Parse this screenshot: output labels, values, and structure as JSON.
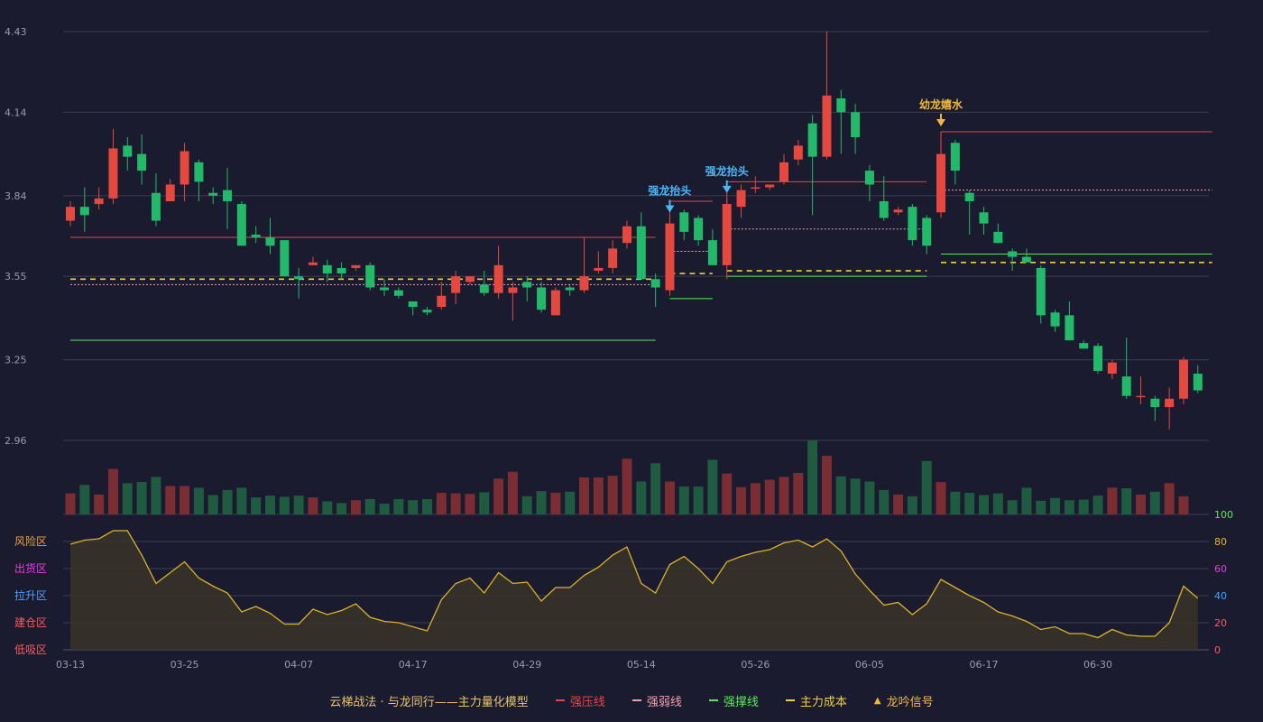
{
  "chart_data": {
    "type": "candlestick",
    "price_axis": {
      "ticks": [
        "4.43",
        "4.14",
        "3.84",
        "3.55",
        "3.25",
        "2.96"
      ],
      "range": [
        2.96,
        4.43
      ]
    },
    "indicator_axis": {
      "ticks": [
        "100",
        "80",
        "60",
        "40",
        "20",
        "0"
      ],
      "range": [
        0,
        100
      ]
    },
    "zone_labels": [
      "风险区",
      "出货区",
      "拉升区",
      "建仓区",
      "低吸区"
    ],
    "x_tick_labels": [
      {
        "label": "03-13",
        "index": 0
      },
      {
        "label": "03-25",
        "index": 8
      },
      {
        "label": "04-07",
        "index": 16
      },
      {
        "label": "04-17",
        "index": 24
      },
      {
        "label": "04-29",
        "index": 32
      },
      {
        "label": "05-14",
        "index": 40
      },
      {
        "label": "05-26",
        "index": 48
      },
      {
        "label": "06-05",
        "index": 56
      },
      {
        "label": "06-17",
        "index": 64
      },
      {
        "label": "06-30",
        "index": 72
      }
    ],
    "candles": [
      [
        3.75,
        3.8,
        3.82,
        3.73
      ],
      [
        3.8,
        3.77,
        3.87,
        3.71
      ],
      [
        3.81,
        3.83,
        3.87,
        3.79
      ],
      [
        3.83,
        4.01,
        4.08,
        3.81
      ],
      [
        4.02,
        3.98,
        4.05,
        3.93
      ],
      [
        3.99,
        3.93,
        4.06,
        3.88
      ],
      [
        3.85,
        3.75,
        3.92,
        3.73
      ],
      [
        3.82,
        3.88,
        3.9,
        3.82
      ],
      [
        3.88,
        4.0,
        4.03,
        3.82
      ],
      [
        3.96,
        3.89,
        3.97,
        3.82
      ],
      [
        3.85,
        3.84,
        3.87,
        3.81
      ],
      [
        3.86,
        3.82,
        3.94,
        3.72
      ],
      [
        3.81,
        3.66,
        3.82,
        3.66
      ],
      [
        3.7,
        3.69,
        3.73,
        3.67
      ],
      [
        3.69,
        3.66,
        3.76,
        3.63
      ],
      [
        3.68,
        3.55,
        3.68,
        3.55
      ],
      [
        3.55,
        3.54,
        3.58,
        3.47
      ],
      [
        3.59,
        3.6,
        3.62,
        3.59
      ],
      [
        3.59,
        3.56,
        3.61,
        3.53
      ],
      [
        3.58,
        3.56,
        3.6,
        3.54
      ],
      [
        3.58,
        3.59,
        3.59,
        3.57
      ],
      [
        3.59,
        3.51,
        3.6,
        3.5
      ],
      [
        3.51,
        3.5,
        3.54,
        3.48
      ],
      [
        3.5,
        3.48,
        3.51,
        3.47
      ],
      [
        3.46,
        3.44,
        3.45,
        3.41
      ],
      [
        3.43,
        3.42,
        3.44,
        3.41
      ],
      [
        3.44,
        3.48,
        3.53,
        3.43
      ],
      [
        3.49,
        3.55,
        3.57,
        3.45
      ],
      [
        3.53,
        3.55,
        3.55,
        3.52
      ],
      [
        3.52,
        3.49,
        3.57,
        3.48
      ],
      [
        3.49,
        3.59,
        3.66,
        3.47
      ],
      [
        3.49,
        3.51,
        3.53,
        3.39
      ],
      [
        3.53,
        3.51,
        3.55,
        3.46
      ],
      [
        3.51,
        3.43,
        3.53,
        3.42
      ],
      [
        3.41,
        3.5,
        3.51,
        3.41
      ],
      [
        3.51,
        3.5,
        3.52,
        3.48
      ],
      [
        3.5,
        3.55,
        3.69,
        3.49
      ],
      [
        3.57,
        3.58,
        3.64,
        3.56
      ],
      [
        3.58,
        3.65,
        3.68,
        3.56
      ],
      [
        3.67,
        3.73,
        3.75,
        3.65
      ],
      [
        3.73,
        3.54,
        3.78,
        3.54
      ],
      [
        3.54,
        3.51,
        3.56,
        3.44
      ],
      [
        3.5,
        3.74,
        3.76,
        3.48
      ],
      [
        3.78,
        3.71,
        3.79,
        3.68
      ],
      [
        3.76,
        3.68,
        3.77,
        3.66
      ],
      [
        3.68,
        3.59,
        3.72,
        3.59
      ],
      [
        3.59,
        3.81,
        3.83,
        3.54
      ],
      [
        3.8,
        3.86,
        3.88,
        3.76
      ],
      [
        3.87,
        3.87,
        3.91,
        3.85
      ],
      [
        3.87,
        3.88,
        3.88,
        3.86
      ],
      [
        3.89,
        3.96,
        3.99,
        3.88
      ],
      [
        3.97,
        4.02,
        4.04,
        3.95
      ],
      [
        4.1,
        3.98,
        4.13,
        3.77
      ],
      [
        3.98,
        4.2,
        4.43,
        3.97
      ],
      [
        4.19,
        4.14,
        4.22,
        3.99
      ],
      [
        4.14,
        4.05,
        4.17,
        3.99
      ],
      [
        3.93,
        3.88,
        3.95,
        3.82
      ],
      [
        3.82,
        3.76,
        3.91,
        3.75
      ],
      [
        3.78,
        3.79,
        3.8,
        3.77
      ],
      [
        3.8,
        3.68,
        3.81,
        3.66
      ],
      [
        3.76,
        3.66,
        3.77,
        3.63
      ],
      [
        3.78,
        3.99,
        4.07,
        3.76
      ],
      [
        4.03,
        3.93,
        4.04,
        3.88
      ],
      [
        3.85,
        3.82,
        3.86,
        3.7
      ],
      [
        3.78,
        3.74,
        3.8,
        3.7
      ],
      [
        3.71,
        3.67,
        3.74,
        3.67
      ],
      [
        3.64,
        3.62,
        3.65,
        3.57
      ],
      [
        3.62,
        3.6,
        3.65,
        3.6
      ],
      [
        3.58,
        3.41,
        3.59,
        3.38
      ],
      [
        3.42,
        3.37,
        3.43,
        3.35
      ],
      [
        3.41,
        3.32,
        3.46,
        3.32
      ],
      [
        3.31,
        3.29,
        3.32,
        3.29
      ],
      [
        3.3,
        3.21,
        3.31,
        3.2
      ],
      [
        3.2,
        3.24,
        3.25,
        3.18
      ],
      [
        3.19,
        3.12,
        3.33,
        3.11
      ],
      [
        3.12,
        3.12,
        3.19,
        3.09
      ],
      [
        3.11,
        3.08,
        3.12,
        3.03
      ],
      [
        3.08,
        3.11,
        3.15,
        3.0
      ],
      [
        3.11,
        3.25,
        3.26,
        3.09
      ],
      [
        3.2,
        3.14,
        3.23,
        3.13
      ]
    ],
    "volume": [
      37,
      52,
      35,
      80,
      55,
      57,
      66,
      50,
      50,
      47,
      34,
      43,
      47,
      30,
      33,
      31,
      33,
      30,
      23,
      20,
      25,
      27,
      19,
      27,
      25,
      27,
      38,
      37,
      36,
      39,
      63,
      75,
      32,
      41,
      38,
      40,
      65,
      65,
      68,
      98,
      58,
      90,
      58,
      49,
      49,
      96,
      72,
      48,
      55,
      61,
      66,
      73,
      130,
      103,
      67,
      63,
      58,
      43,
      35,
      32,
      94,
      57,
      40,
      38,
      34,
      37,
      25,
      47,
      24,
      29,
      25,
      26,
      33,
      47,
      46,
      35,
      40,
      55,
      32
    ],
    "indicator": [
      78,
      81,
      82,
      88,
      88,
      70,
      49,
      57,
      65,
      53,
      47,
      42,
      28,
      32,
      27,
      19,
      19,
      30,
      26,
      29,
      34,
      24,
      21,
      20,
      17,
      14,
      37,
      49,
      53,
      42,
      57,
      49,
      50,
      36,
      46,
      46,
      55,
      61,
      70,
      76,
      49,
      42,
      63,
      69,
      60,
      49,
      65,
      69,
      72,
      74,
      79,
      81,
      76,
      82,
      73,
      56,
      44,
      33,
      35,
      26,
      34,
      52,
      46,
      40,
      35,
      28,
      25,
      21,
      15,
      17,
      12,
      12,
      9,
      15,
      11,
      10,
      10,
      20,
      47,
      38
    ],
    "levels": [
      {
        "type": "强压线",
        "start": 0,
        "end": 41,
        "price": 3.69
      },
      {
        "type": "强弱线",
        "start": 0,
        "end": 41,
        "price": 3.52
      },
      {
        "type": "主力成本",
        "start": 0,
        "end": 41,
        "price": 3.54
      },
      {
        "type": "强撑线",
        "start": 0,
        "end": 41,
        "price": 3.32
      },
      {
        "type": "强压线",
        "start": 42,
        "end": 45,
        "price": 3.82
      },
      {
        "type": "强弱线",
        "start": 42,
        "end": 45,
        "price": 3.64
      },
      {
        "type": "主力成本",
        "start": 42,
        "end": 45,
        "price": 3.56
      },
      {
        "type": "强撑线",
        "start": 42,
        "end": 45,
        "price": 3.47
      },
      {
        "type": "强压线",
        "start": 46,
        "end": 60,
        "price": 3.89
      },
      {
        "type": "强弱线",
        "start": 46,
        "end": 60,
        "price": 3.72
      },
      {
        "type": "主力成本",
        "start": 46,
        "end": 60,
        "price": 3.57
      },
      {
        "type": "强撑线",
        "start": 46,
        "end": 60,
        "price": 3.55
      },
      {
        "type": "强压线",
        "start": 61,
        "end": 80,
        "price": 4.07
      },
      {
        "type": "强弱线",
        "start": 61,
        "end": 80,
        "price": 3.86
      },
      {
        "type": "主力成本",
        "start": 61,
        "end": 80,
        "price": 3.6
      },
      {
        "type": "强撑线",
        "start": 61,
        "end": 80,
        "price": 3.63
      }
    ],
    "signals": [
      {
        "label": "强龙抬头",
        "index": 42
      },
      {
        "label": "强龙抬头",
        "index": 46
      },
      {
        "label": "幼龙嬉水",
        "index": 61
      }
    ],
    "legend": {
      "title": "云梯战法 · 与龙同行——主力量化模型",
      "items": [
        {
          "label": "强压线",
          "style": "solid",
          "color": "#e04848"
        },
        {
          "label": "强弱线",
          "style": "dashed",
          "color": "#f0a0b0"
        },
        {
          "label": "强撑线",
          "style": "solid",
          "color": "#5ee85e"
        },
        {
          "label": "主力成本",
          "style": "dashed",
          "color": "#f0d040"
        },
        {
          "label": "龙吟信号",
          "style": "triangle",
          "color": "#f0b840"
        }
      ]
    },
    "colors": {
      "up": "#e4483f",
      "down": "#23b96a",
      "signal_blue": "#4fb6f5",
      "signal_gold": "#f0b840",
      "indicator_line": "#d9b32a"
    }
  }
}
